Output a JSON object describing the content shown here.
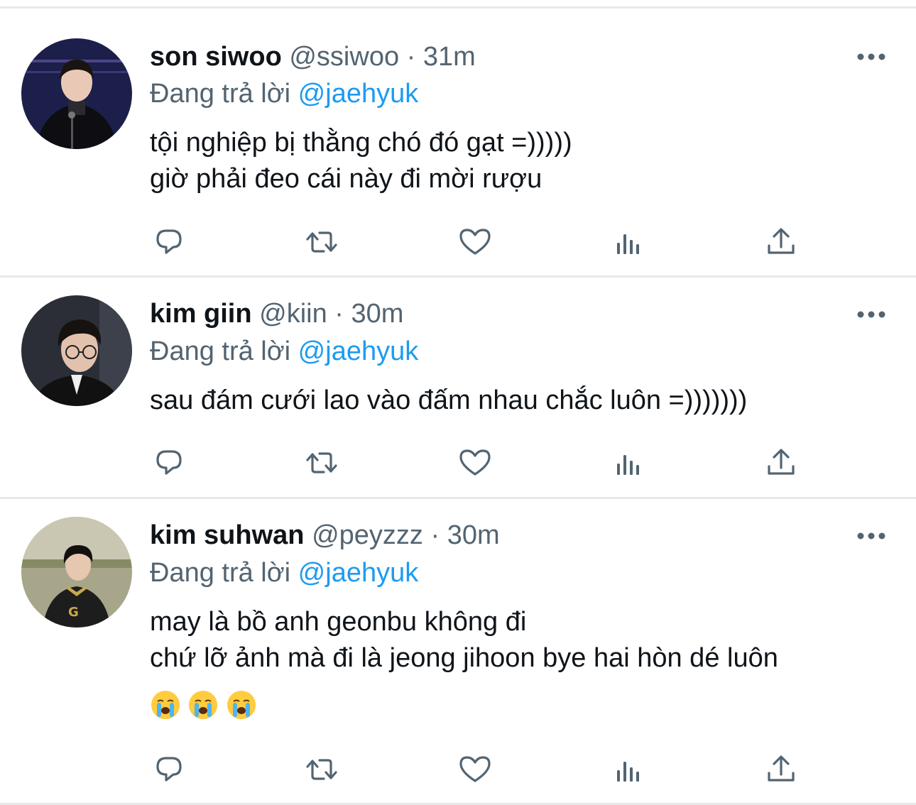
{
  "tweets": [
    {
      "display_name": "son siwoo",
      "handle": "@ssiwoo",
      "separator": "·",
      "time": "31m",
      "reply_prefix": "Đang trả lời",
      "reply_to": "@jaehyuk",
      "lines": [
        "tội nghiệp bị thằng chó đó gạt =)))))",
        "giờ phải đeo cái này đi mời rượu"
      ]
    },
    {
      "display_name": "kim giin",
      "handle": "@kiin",
      "separator": "·",
      "time": "30m",
      "reply_prefix": "Đang trả lời",
      "reply_to": "@jaehyuk",
      "lines": [
        "sau đám cưới lao vào đấm nhau chắc luôn =)))))))"
      ]
    },
    {
      "display_name": "kim suhwan",
      "handle": "@peyzzz",
      "separator": "·",
      "time": "30m",
      "reply_prefix": "Đang trả lời",
      "reply_to": "@jaehyuk",
      "lines": [
        "may là bồ anh geonbu không đi",
        "chứ lỡ ảnh mà đi là jeong jihoon bye hai hòn dé luôn"
      ],
      "emojis": [
        "loudly-crying-face",
        "loudly-crying-face",
        "loudly-crying-face"
      ]
    }
  ],
  "actions": [
    "reply-icon",
    "retweet-icon",
    "like-icon",
    "views-icon",
    "share-icon"
  ],
  "colors": {
    "mention": "#1d9bf0",
    "meta": "#536471",
    "icon": "#536471",
    "divider": "#e6e9eb"
  }
}
